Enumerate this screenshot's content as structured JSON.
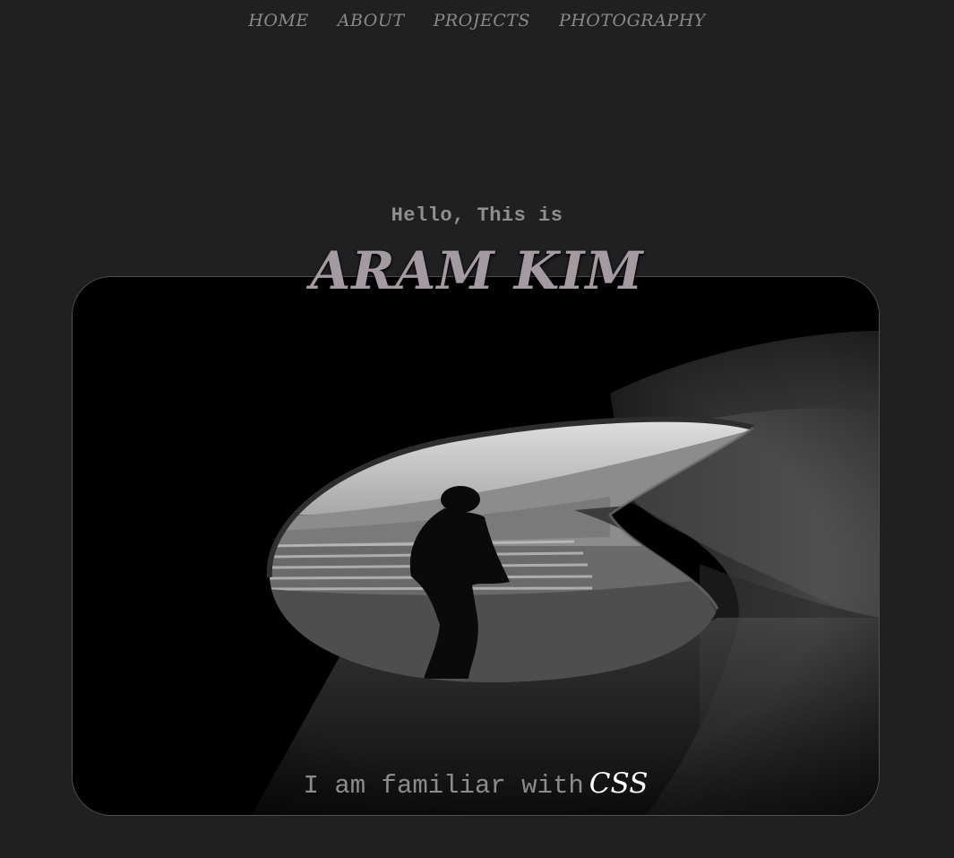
{
  "nav": {
    "items": [
      {
        "label": "HOME"
      },
      {
        "label": "ABOUT"
      },
      {
        "label": "PROJECTS"
      },
      {
        "label": "PHOTOGRAPHY"
      }
    ]
  },
  "hero": {
    "greeting": "Hello, This is",
    "name": "ARAM KIM"
  },
  "familiar": {
    "prefix": "I am familiar with",
    "skill": "CSS"
  },
  "colors": {
    "background": "#202020",
    "nav_text": "#8a8a8a",
    "name_text": "#a39aa2",
    "skill_text": "#ffffff"
  },
  "photo": {
    "subject": "black-and-white photo of a silhouetted person walking inside a tunnel with an oval opening"
  }
}
